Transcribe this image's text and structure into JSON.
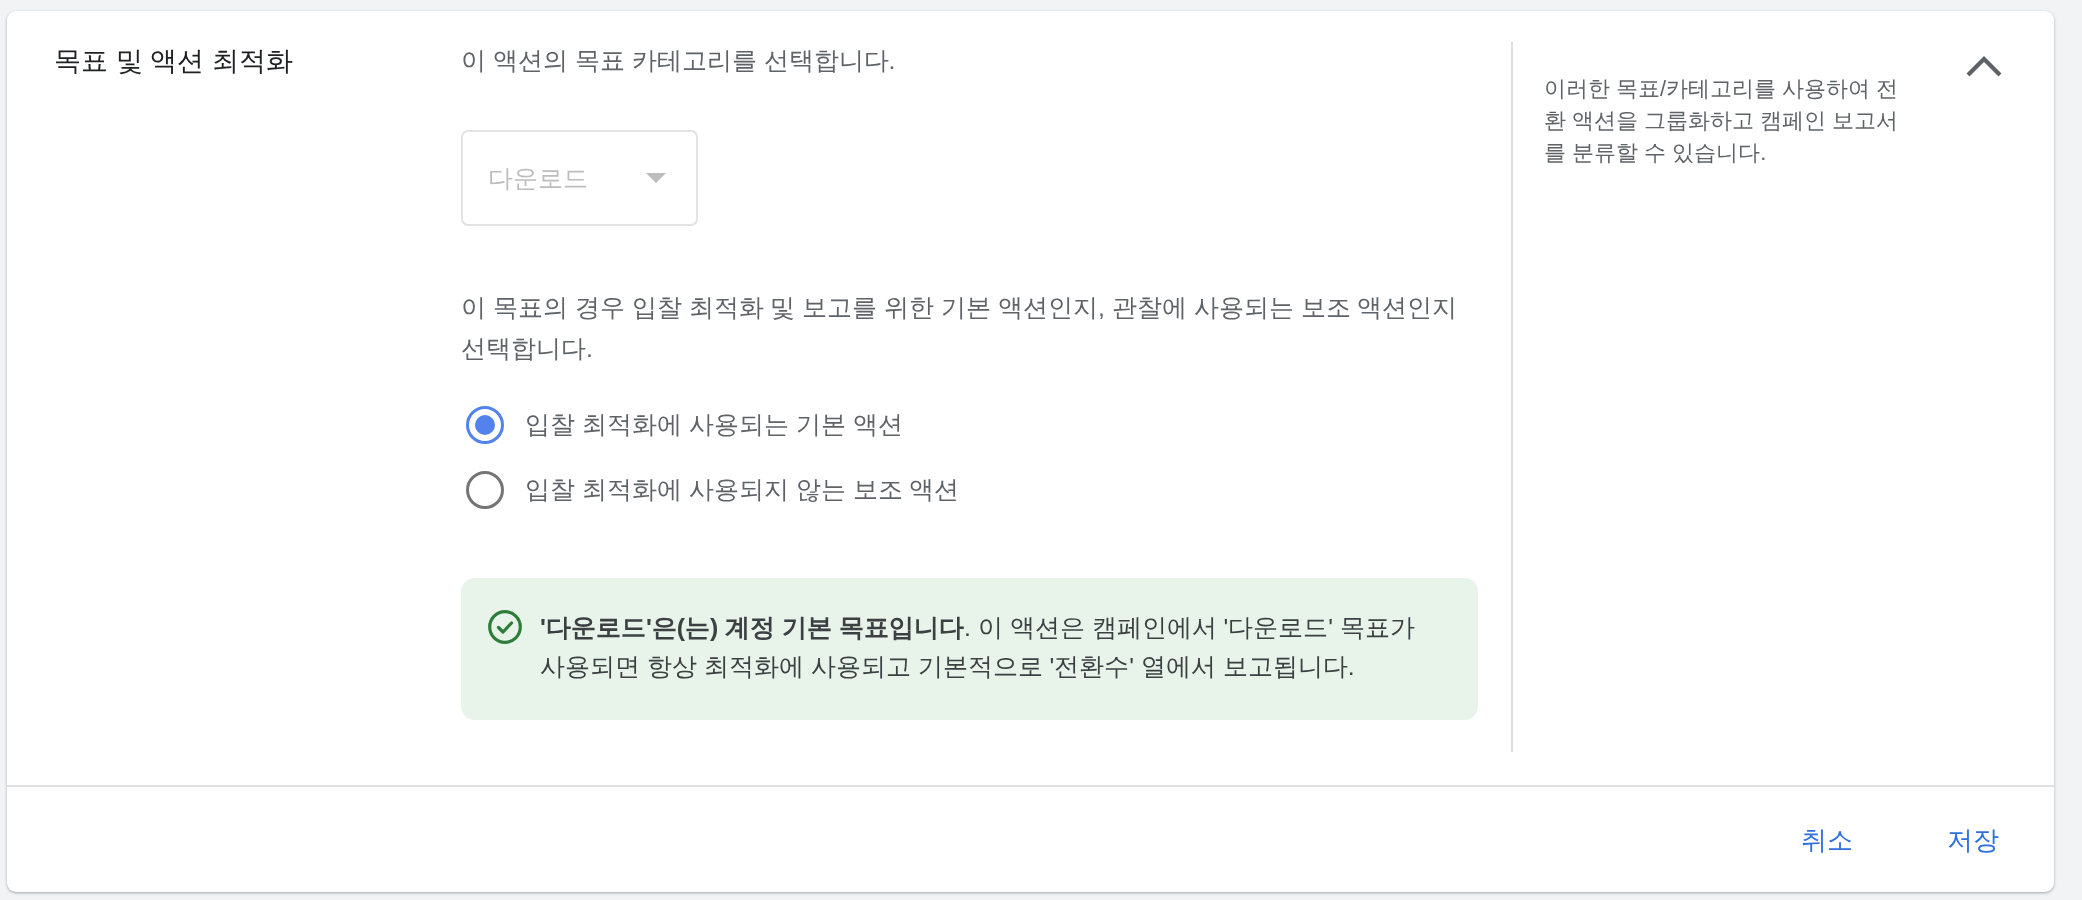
{
  "section": {
    "title": "목표 및 액션 최적화",
    "expanded": true
  },
  "category": {
    "prompt": "이 액션의 목표 카테고리를 선택합니다.",
    "dropdown": {
      "value": "다운로드",
      "disabled": true
    }
  },
  "action_type": {
    "prompt": "이 목표의 경우 입찰 최적화 및 보고를 위한 기본 액션인지, 관찰에 사용되는 보조 액션인지 선택합니다.",
    "options": [
      {
        "label": "입찰 최적화에 사용되는 기본 액션",
        "selected": true
      },
      {
        "label": "입찰 최적화에 사용되지 않는 보조 액션",
        "selected": false
      }
    ]
  },
  "alert": {
    "text": "**'다운로드'은(는) 계정 기본 목표입니다**. 이 액션은 캠페인에서 '다운로드' 목표가 사용되면 항상 최적화에 사용되고 기본적으로 '전환수' 열에서 보고됩니다."
  },
  "help_text": "이러한 목표/카테고리를 사용하여 전환 액션을 그룹화하고 캠페인 보고서를 분류할 수 있습니다.",
  "buttons": [
    {
      "label": "취소"
    },
    {
      "label": "저장"
    }
  ]
}
